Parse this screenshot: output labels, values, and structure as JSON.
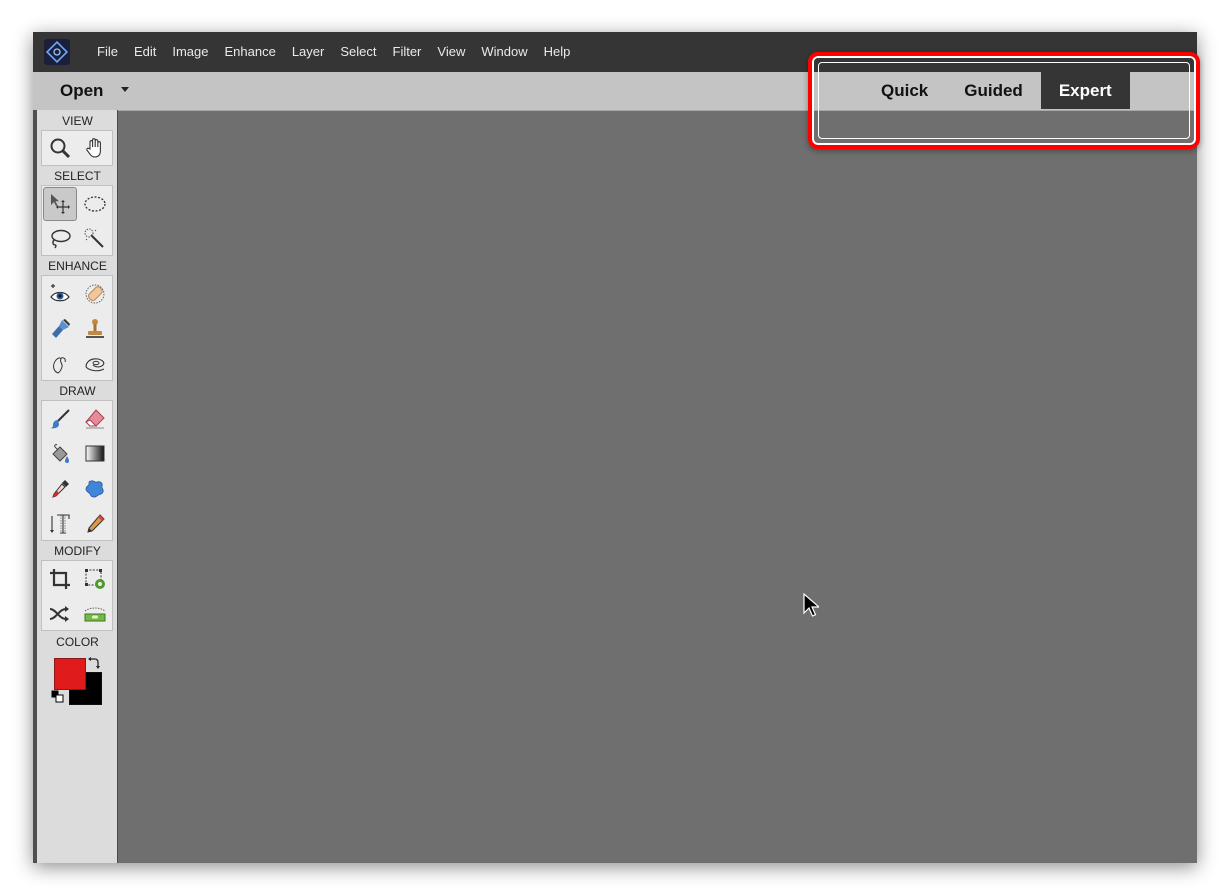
{
  "menu": [
    "File",
    "Edit",
    "Image",
    "Enhance",
    "Layer",
    "Select",
    "Filter",
    "View",
    "Window",
    "Help"
  ],
  "optionbar": {
    "open_label": "Open",
    "modes": [
      {
        "label": "Quick",
        "active": false
      },
      {
        "label": "Guided",
        "active": false
      },
      {
        "label": "Expert",
        "active": true
      }
    ]
  },
  "toolbox": {
    "sections": {
      "view": "VIEW",
      "select": "SELECT",
      "enhance": "ENHANCE",
      "draw": "DRAW",
      "modify": "MODIFY",
      "color": "COLOR"
    },
    "tools": {
      "view": [
        "zoom-icon",
        "hand-icon"
      ],
      "select": [
        "move-icon",
        "elliptical-marquee-icon",
        "lasso-icon",
        "quick-selection-icon"
      ],
      "enhance": [
        "red-eye-icon",
        "spot-healing-icon",
        "smart-brush-icon",
        "clone-stamp-icon",
        "blur-icon",
        "sponge-icon"
      ],
      "draw": [
        "brush-icon",
        "eraser-icon",
        "paint-bucket-icon",
        "gradient-icon",
        "eyedropper-icon",
        "custom-shape-icon",
        "type-icon",
        "pencil-icon"
      ],
      "modify": [
        "crop-icon",
        "recompose-icon",
        "content-aware-move-icon",
        "straighten-icon"
      ]
    }
  },
  "colors": {
    "foreground": "#e01b1b",
    "background": "#000000",
    "highlight": "#ff0000"
  }
}
